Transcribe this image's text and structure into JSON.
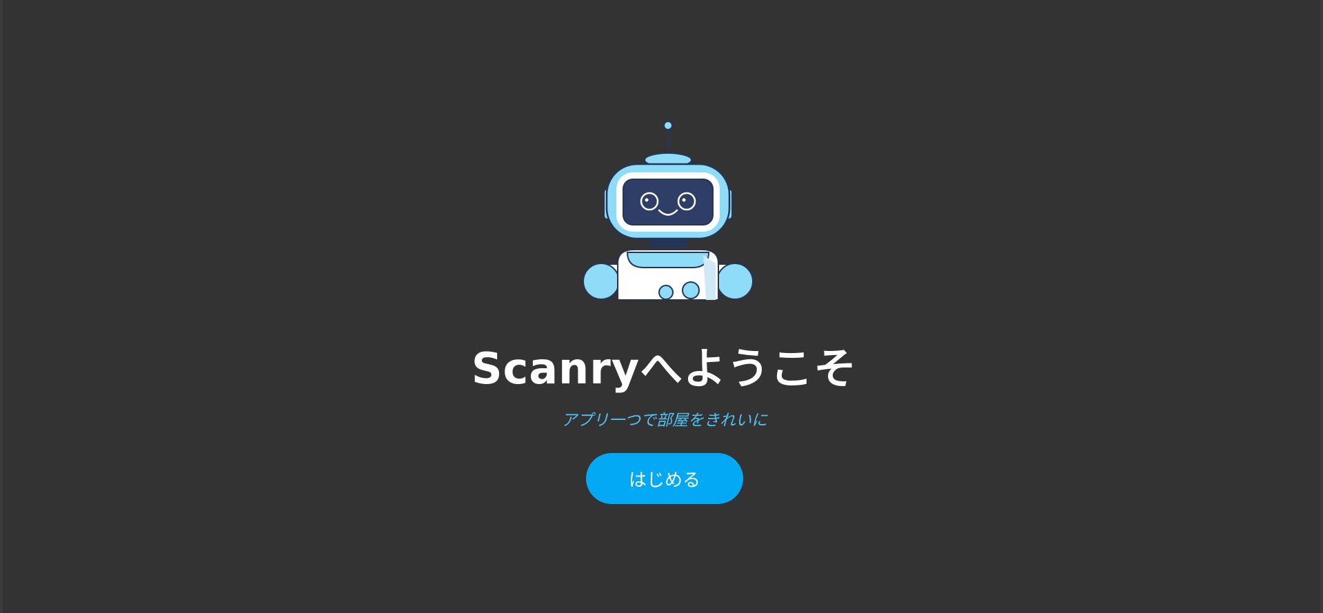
{
  "welcome": {
    "title": "Scanryへようこそ",
    "subtitle": "アプリ一つで部屋をきれいに",
    "start_button_label": "はじめる"
  },
  "illustration": {
    "name": "robot-mascot",
    "colors": {
      "body": "#ffffff",
      "accent": "#8fdcf9",
      "screen": "#2f3e66",
      "outline": "#263455"
    }
  },
  "colors": {
    "background": "#333333",
    "title": "#ffffff",
    "subtitle": "#4fc3f7",
    "button": "#03a9f4",
    "button_text": "#ffffff"
  }
}
